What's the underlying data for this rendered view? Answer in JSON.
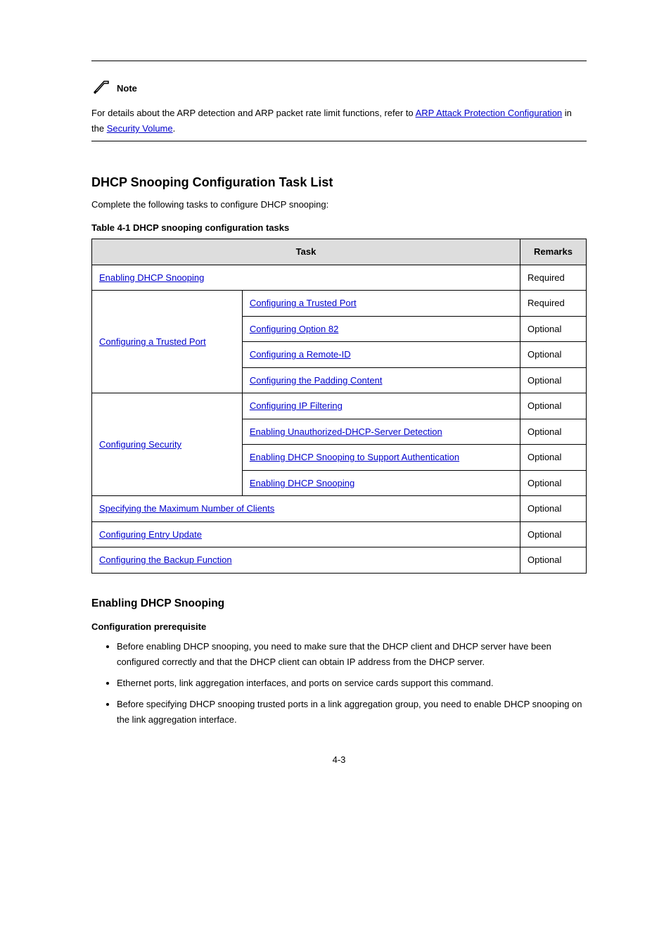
{
  "note": {
    "label": "Note",
    "text_prefix": "For details about the ARP detection and ARP packet rate limit functions, refer to ",
    "link": "ARP Attack Protection Configuration",
    "text_suffix": " in the ",
    "emph": "Security Volume",
    "tail": "."
  },
  "section": {
    "title": "DHCP Snooping Configuration Task List",
    "intro": "Complete the following tasks to configure DHCP snooping:",
    "table_caption": "Table 4-1 DHCP snooping configuration tasks"
  },
  "table": {
    "headers": {
      "task": "Task",
      "remarks": "Remarks"
    },
    "rows": [
      {
        "task": "Enabling DHCP Snooping",
        "remark": "Required",
        "colspan": 2
      },
      {
        "group": "Configuring a Trusted Port",
        "subs": [
          {
            "task": "Configuring a Trusted Port",
            "remark": "Required"
          },
          {
            "task": "Configuring Option 82",
            "remark": "Optional"
          },
          {
            "task": "Configuring a Remote-ID",
            "remark": "Optional"
          },
          {
            "task": "Configuring the Padding Content",
            "remark": "Optional"
          }
        ]
      },
      {
        "group": "Configuring Security",
        "subs": [
          {
            "task": "Configuring IP Filtering",
            "remark": "Optional"
          },
          {
            "task": "Enabling Unauthorized-DHCP-Server Detection",
            "remark": "Optional"
          },
          {
            "task": "Enabling DHCP Snooping to Support Authentication",
            "remark": "Optional"
          },
          {
            "task": "Enabling DHCP Snooping",
            "remark": "Optional"
          }
        ]
      },
      {
        "task": "Specifying the Maximum Number of Clients",
        "remark": "Optional",
        "colspan": 2
      },
      {
        "task": "Configuring Entry Update",
        "remark": "Optional",
        "colspan": 2
      },
      {
        "task": "Configuring the Backup Function",
        "remark": "Optional",
        "colspan": 2
      }
    ]
  },
  "subsection": {
    "title": "Enabling DHCP Snooping",
    "config_prereq_title": "Configuration prerequisite",
    "bullets": [
      "Before enabling DHCP snooping, you need to make sure that the DHCP client and DHCP server have been configured correctly and that the DHCP client can obtain IP address from the DHCP server.",
      "Ethernet ports, link aggregation interfaces, and ports on service cards support this command.",
      "Before specifying DHCP snooping trusted ports in a link aggregation group, you need to enable DHCP snooping on the link aggregation interface."
    ]
  },
  "page_number": "4-3"
}
